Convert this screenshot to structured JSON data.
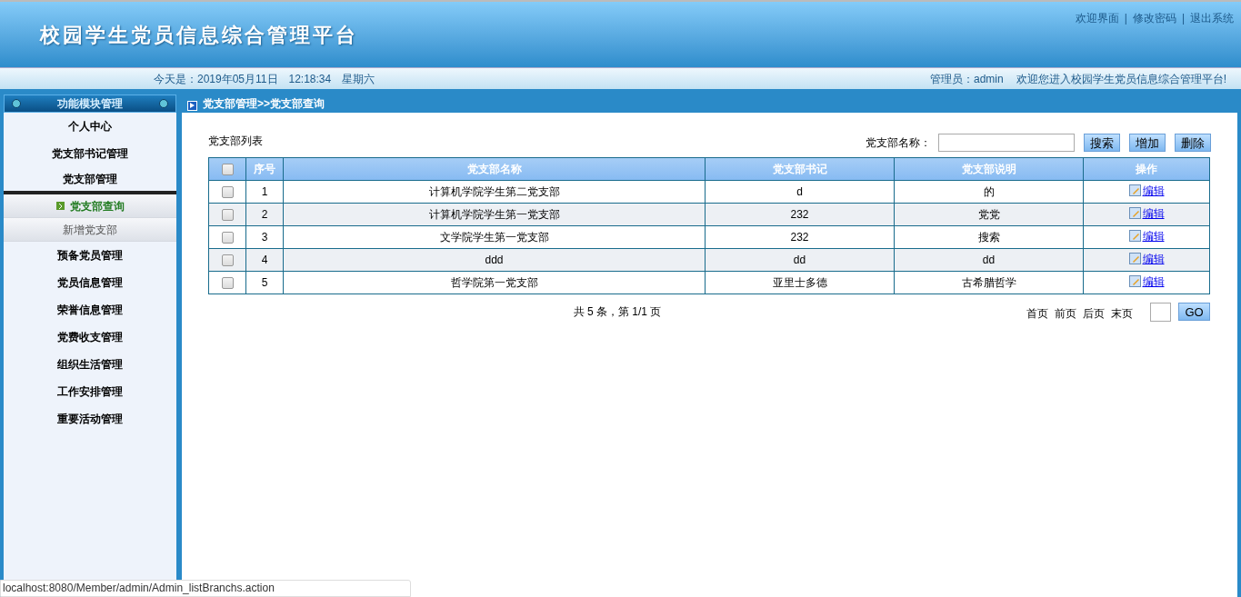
{
  "header": {
    "title": "校园学生党员信息综合管理平台",
    "links": [
      "欢迎界面",
      "修改密码",
      "退出系统"
    ],
    "separator": "|"
  },
  "info_bar": {
    "date": "今天是：2019年05月11日　12:18:34　星期六",
    "user": "管理员：admin",
    "welcome": "欢迎您进入校园学生党员信息综合管理平台!"
  },
  "sidebar": {
    "title": "功能模块管理",
    "items": [
      {
        "label": "个人中心",
        "expanded": false
      },
      {
        "label": "党支部书记管理",
        "expanded": false
      },
      {
        "label": "党支部管理",
        "expanded": true,
        "children": [
          {
            "label": "党支部查询",
            "selected": true
          },
          {
            "label": "新增党支部",
            "selected": false
          }
        ]
      },
      {
        "label": "预备党员管理",
        "expanded": false
      },
      {
        "label": "党员信息管理",
        "expanded": false
      },
      {
        "label": "荣誉信息管理",
        "expanded": false
      },
      {
        "label": "党费收支管理",
        "expanded": false
      },
      {
        "label": "组织生活管理",
        "expanded": false
      },
      {
        "label": "工作安排管理",
        "expanded": false
      },
      {
        "label": "重要活动管理",
        "expanded": false
      }
    ]
  },
  "breadcrumb": "党支部管理>>党支部查询",
  "list_title": "党支部列表",
  "search": {
    "label": "党支部名称："
  },
  "buttons": [
    "搜索",
    "增加",
    "删除"
  ],
  "table": {
    "select_all": false,
    "columns": [
      "序号",
      "党支部名称",
      "党支部书记",
      "党支部说明",
      "操作"
    ],
    "rows": [
      {
        "checked": false,
        "cells": [
          "1",
          "计算机学院学生第二党支部",
          "d",
          "的"
        ],
        "action": "编辑"
      },
      {
        "checked": false,
        "cells": [
          "2",
          "计算机学院学生第一党支部",
          "232",
          "党党"
        ],
        "action": "编辑"
      },
      {
        "checked": false,
        "cells": [
          "3",
          "文学院学生第一党支部",
          "232",
          "搜索"
        ],
        "action": "编辑"
      },
      {
        "checked": false,
        "cells": [
          "4",
          "ddd",
          "dd",
          "dd"
        ],
        "action": "编辑"
      },
      {
        "checked": false,
        "cells": [
          "5",
          "哲学院第一党支部",
          "亚里士多德",
          "古希腊哲学"
        ],
        "action": "编辑"
      }
    ]
  },
  "pagination": {
    "summary": "共 5 条，第 1/1 页",
    "links": [
      "首页",
      "前页",
      "后页",
      "末页"
    ],
    "go": "GO"
  },
  "status_bar": "localhost:8080/Member/admin/Admin_listBranchs.action"
}
